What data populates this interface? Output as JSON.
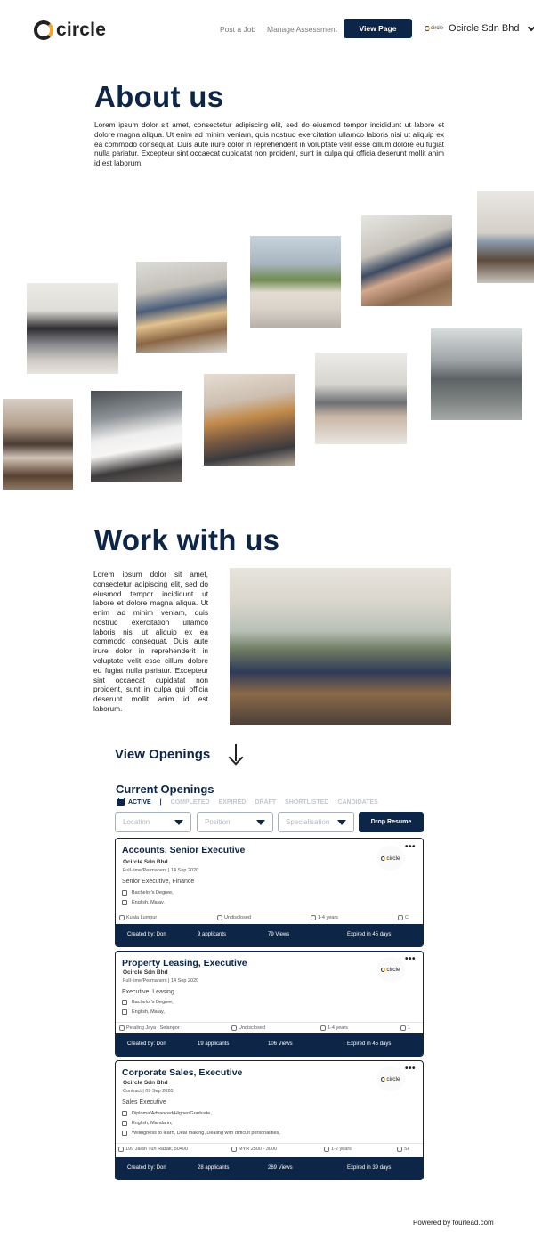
{
  "header": {
    "logo_text": "circle",
    "nav": [
      "Post a Job",
      "Manage Assessment"
    ],
    "view_page_label": "View Page",
    "company_logo_text": "circle",
    "company_name": "Ocircle Sdn Bhd"
  },
  "about": {
    "title": "About us",
    "body": "Lorem ipsum dolor sit amet, consectetur adipiscing elit, sed do eiusmod tempor incididunt ut labore et dolore magna aliqua. Ut enim ad minim veniam, quis nostrud exercitation ullamco laboris nisi ut aliquip ex ea commodo consequat. Duis aute irure dolor in reprehenderit in voluptate velit esse cillum dolore eu fugiat nulla pariatur. Excepteur sint occaecat cupidatat non proident, sunt in culpa qui officia deserunt mollit anim id est laborum."
  },
  "work": {
    "title": "Work with us",
    "body": "Lorem ipsum dolor sit amet, consectetur adipiscing elit, sed do eiusmod tempor incididunt ut labore et dolore magna aliqua. Ut enim ad minim veniam, quis nostrud exercitation ullamco laboris nisi ut aliquip ex ea commodo consequat. Duis aute irure dolor in reprehenderit in voluptate velit esse cillum dolore eu fugiat nulla pariatur. Excepteur sint occaecat cupidatat non proident, sunt in culpa qui officia deserunt mollit anim id est laborum."
  },
  "openings": {
    "view_label": "View Openings",
    "current_title": "Current Openings",
    "tabs": [
      "ACTIVE",
      "COMPLETED",
      "EXPIRED",
      "DRAFT",
      "SHORTLISTED",
      "CANDIDATES"
    ],
    "tab_separator": "|",
    "filters": [
      "Location",
      "Position",
      "Specialisation"
    ],
    "drop_resume_label": "Drop Resume",
    "more_label": "•••",
    "jobs": [
      {
        "title": "Accounts, Senior Executive",
        "company": "Ocircle Sdn Bhd",
        "meta": "Full-time/Permanent | 14 Sep 2020",
        "role": "Senior Executive, Finance",
        "reqs": [
          "Bachelor's Degree,",
          "English,  Malay,"
        ],
        "location": "Kuala Lumpur",
        "salary": "Undisclosed",
        "experience": "1-4 years",
        "extra": "C",
        "created_by": "Created by: Don",
        "applicants": "9 applicants",
        "views": "79 Views",
        "expiry": "Expired in 45 days"
      },
      {
        "title": "Property Leasing, Executive",
        "company": "Ocircle Sdn Bhd",
        "meta": "Full-time/Permanent | 14 Sep 2020",
        "role": "Executive, Leasing",
        "reqs": [
          "Bachelor's Degree,",
          "English,  Malay,"
        ],
        "location": "Petaling Jaya , Selangor",
        "salary": "Undisclosed",
        "experience": "1-4 years",
        "extra": "1",
        "created_by": "Created by: Don",
        "applicants": "19 applicants",
        "views": "106 Views",
        "expiry": "Expired in 45 days"
      },
      {
        "title": "Corporate Sales, Executive",
        "company": "Ocircle Sdn Bhd",
        "meta": "Contract | 09 Sep 2020",
        "role": "Sales Executive",
        "reqs": [
          "Diploma/Advanced/Higher/Graduate,",
          "English,  Mandarin,",
          "Willingness to learn,  Deal making,  Dealing with difficult personalities,"
        ],
        "location": "199 Jalan Tun Razak, 50400",
        "salary": "MYR 2500 - 3000",
        "experience": "1-2 years",
        "extra": "Si",
        "created_by": "Created by: Don",
        "applicants": "28 applicants",
        "views": "269 Views",
        "expiry": "Expired in 39 days"
      }
    ]
  },
  "footer": {
    "powered": "Powered by fourlead.com"
  }
}
